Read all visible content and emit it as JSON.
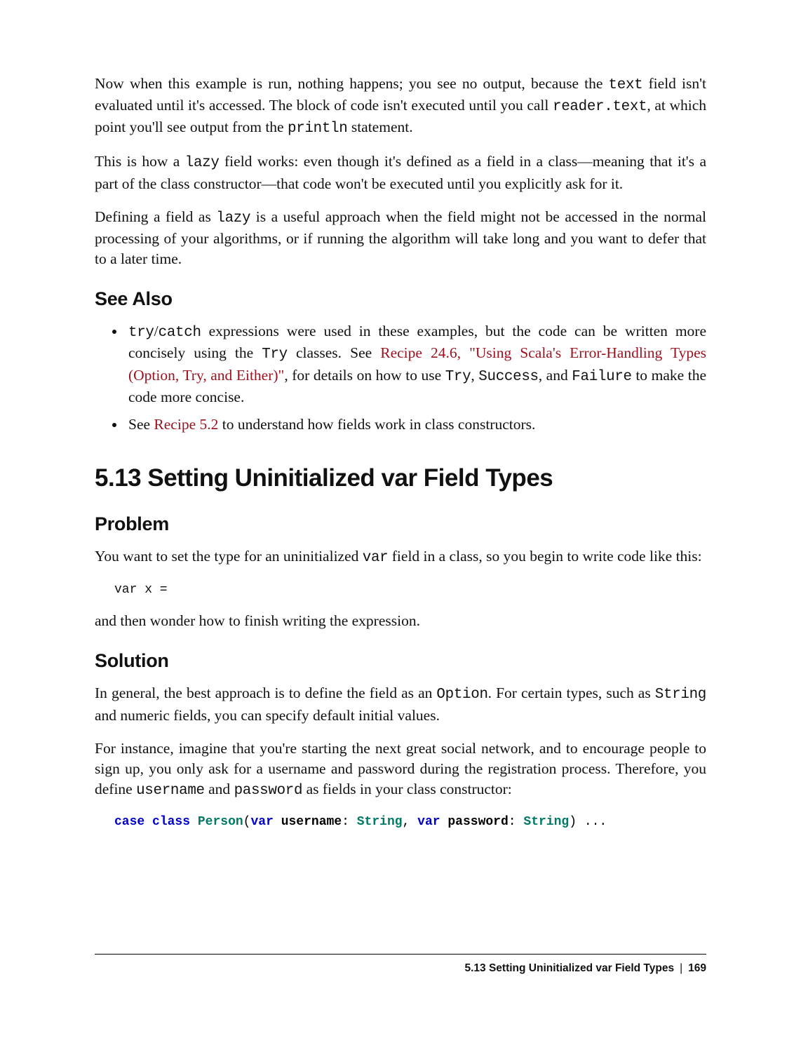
{
  "paragraphs": {
    "intro1_a": "Now when this example is run, nothing happens; you see no output, because the ",
    "intro1_code1": "text",
    "intro1_b": " field isn't evaluated until it's accessed. The block of code isn't executed until you call ",
    "intro1_code2": "reader.text",
    "intro1_c": ", at which point you'll see output from the ",
    "intro1_code3": "println",
    "intro1_d": " statement.",
    "para2_a": "This is how a ",
    "para2_code1": "lazy",
    "para2_b": " field works: even though it's defined as a field in a class—meaning that it's a part of the class constructor—that code won't be executed until you explicitly ask for it.",
    "para3_a": "Defining a field as ",
    "para3_code1": "lazy",
    "para3_b": " is a useful approach when the field might not be accessed in the normal processing of your algorithms, or if running the algorithm will take long and you want to defer that to a later time."
  },
  "see_also": {
    "title": "See Also",
    "bullet1_a": "try",
    "bullet1_slash": "/",
    "bullet1_b": "catch",
    "bullet1_c": " expressions were used in these examples, but the code can be written more concisely using the ",
    "bullet1_d": "Try",
    "bullet1_e": " classes. See ",
    "bullet1_link": "Recipe 24.6, \"Using Scala's Error-Handling Types (Option, Try, and Either)\"",
    "bullet1_f": ", for details on how to use ",
    "bullet1_g": "Try",
    "bullet1_h": ", ",
    "bullet1_i": "Suc​cess",
    "bullet1_j": ", and ",
    "bullet1_k": "Failure",
    "bullet1_l": " to make the code more concise.",
    "bullet2_a": "See ",
    "bullet2_link": "Recipe 5.2",
    "bullet2_b": " to understand how fields work in class constructors."
  },
  "section": {
    "title": "5.13 Setting Uninitialized var Field Types",
    "problem_title": "Problem",
    "problem_a": "You want to set the type for an uninitialized ",
    "problem_code1": "var",
    "problem_b": " field in a class, so you begin to write code like this:",
    "code_line": "var x =",
    "problem_c": "and then wonder how to finish writing the expression.",
    "solution_title": "Solution",
    "solution_a": "In general, the best approach is to define the field as an ",
    "solution_code1": "Option",
    "solution_b": ". For certain types, such as ",
    "solution_code2": "String",
    "solution_c": " and numeric fields, you can specify default initial values.",
    "solution_d": "For instance, imagine that you're starting the next great social network, and to encourage people to sign up, you only ask for a username and password during the registration process. Therefore, you define ",
    "solution_code3": "username",
    "solution_e": " and ",
    "solution_code4": "password",
    "solution_f": " as fields in your class constructor:",
    "syntax": {
      "kw1": "case",
      "kw2": "class",
      "kw3": "Person",
      "paren_open": "(",
      "kw4": "var",
      "sp1": " ",
      "id1": "username",
      "colon1": ": ",
      "type1": "String",
      "comma": ", ",
      "kw5": "var",
      "sp2": " ",
      "id2": "password",
      "colon2": ": ",
      "type2": "String",
      "paren_close": ") ..."
    }
  },
  "footer": {
    "chapter": "5.13 Setting Uninitialized var Field Types",
    "separator": "|",
    "page": "169"
  }
}
